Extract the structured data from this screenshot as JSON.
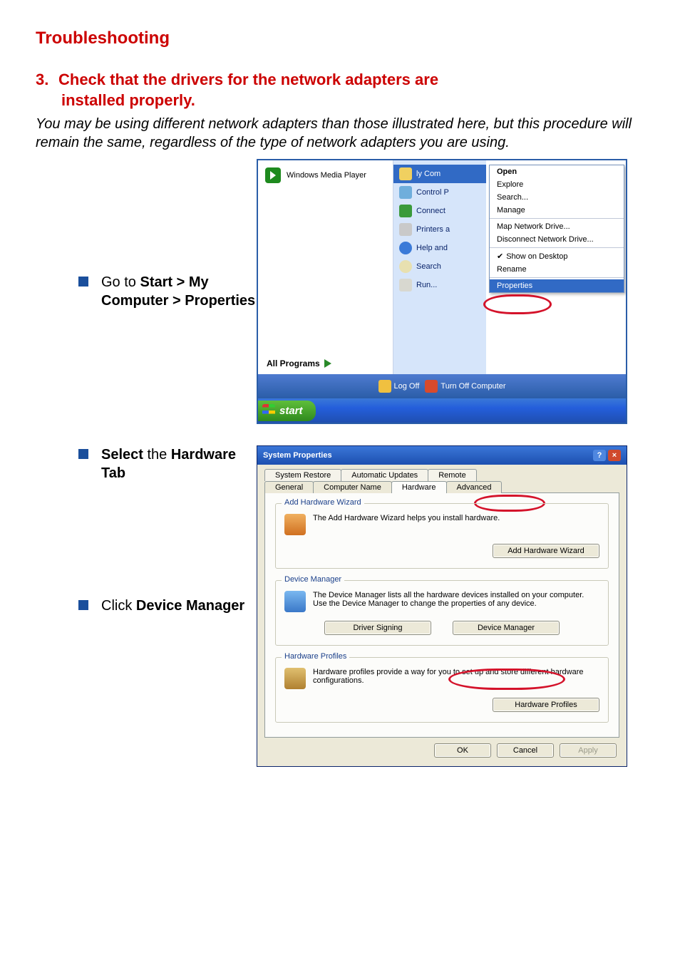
{
  "doc_title": "Troubleshooting",
  "step": {
    "number": "3.",
    "line1": "Check that the drivers for the network adapters are",
    "line2": "installed properly."
  },
  "intro": "You may be using different network adapters than those illustrated here, but this procedure will remain the same, regardless of the type of network adapters you are using.",
  "bullets": {
    "b1_pre": "Go to ",
    "b1_bold": "Start > My Computer > Properties",
    "b2_bold": "Select",
    "b2_post1": " the ",
    "b2_bold2": "Hardware Tab",
    "b3_pre": "Click ",
    "b3_bold": "Device Manager"
  },
  "startmenu": {
    "wmp": "Windows Media Player",
    "all_programs": "All Programs",
    "right": {
      "my_computer": "ly Com",
      "control_panel": "Control P",
      "connect": "Connect",
      "printers": "Printers a",
      "help": "Help and",
      "search": "Search",
      "run": "Run..."
    },
    "ctx": {
      "open": "Open",
      "explore": "Explore",
      "search": "Search...",
      "manage": "Manage",
      "map": "Map Network Drive...",
      "disconnect": "Disconnect Network Drive...",
      "show": "Show on Desktop",
      "rename": "Rename",
      "properties": "Properties"
    },
    "logoff": "Log Off",
    "turnoff": "Turn Off Computer",
    "start": "start"
  },
  "sysprop": {
    "title": "System Properties",
    "tabs_top": {
      "restore": "System Restore",
      "updates": "Automatic Updates",
      "remote": "Remote"
    },
    "tabs_bot": {
      "general": "General",
      "cname": "Computer Name",
      "hardware": "Hardware",
      "advanced": "Advanced"
    },
    "add_hw": {
      "legend": "Add Hardware Wizard",
      "text": "The Add Hardware Wizard helps you install hardware.",
      "btn": "Add Hardware Wizard"
    },
    "devmgr": {
      "legend": "Device Manager",
      "text": "The Device Manager lists all the hardware devices installed on your computer. Use the Device Manager to change the properties of any device.",
      "btn_sign": "Driver Signing",
      "btn_dm": "Device Manager"
    },
    "hwprof": {
      "legend": "Hardware Profiles",
      "text": "Hardware profiles provide a way for you to set up and store different hardware configurations.",
      "btn": "Hardware Profiles"
    },
    "dlg": {
      "ok": "OK",
      "cancel": "Cancel",
      "apply": "Apply"
    }
  }
}
